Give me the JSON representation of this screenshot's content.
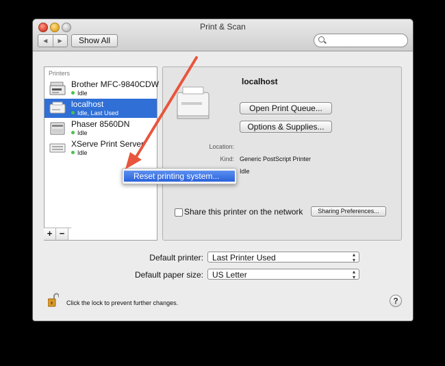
{
  "window": {
    "title": "Print & Scan"
  },
  "toolbar": {
    "show_all": "Show All",
    "back_glyph": "◀",
    "forward_glyph": "▶",
    "search_placeholder": ""
  },
  "printers": {
    "header": "Printers",
    "items": [
      {
        "name": "Brother MFC-9840CDW",
        "status": "Idle",
        "selected": false,
        "icon": "printer-mfc-icon"
      },
      {
        "name": "localhost",
        "status": "Idle, Last Used",
        "selected": true,
        "icon": "printer-generic-icon"
      },
      {
        "name": "Phaser 8560DN",
        "status": "Idle",
        "selected": false,
        "icon": "printer-laser-icon"
      },
      {
        "name": "XServe Print Server",
        "status": "Idle",
        "selected": false,
        "icon": "printer-server-icon"
      }
    ],
    "add_label": "+",
    "remove_label": "−"
  },
  "detail": {
    "name": "localhost",
    "open_queue_label": "Open Print Queue...",
    "options_label": "Options & Supplies...",
    "location_label": "Location:",
    "location_value": "",
    "kind_label": "Kind:",
    "kind_value": "Generic PostScript Printer",
    "status_value": "Idle",
    "share_label": "Share this printer on the network",
    "share_checked": false,
    "sharing_prefs_label": "Sharing Preferences..."
  },
  "context_menu": {
    "item": "Reset printing system..."
  },
  "defaults": {
    "printer_label": "Default printer:",
    "printer_value": "Last Printer Used",
    "paper_label": "Default paper size:",
    "paper_value": "US Letter"
  },
  "footer": {
    "lock_text": "Click the lock to prevent further changes.",
    "help_label": "?"
  },
  "colors": {
    "selection": "#2f6fd6",
    "menu_highlight": "#2a62db",
    "arrow": "#e8553d",
    "status_dot": "#4bc24b"
  }
}
